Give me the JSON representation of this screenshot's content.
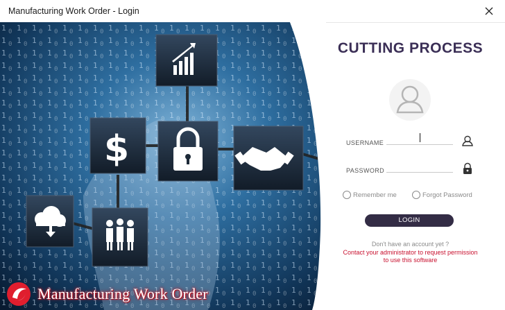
{
  "window": {
    "title": "Manufacturing Work Order - Login"
  },
  "brand": {
    "name": "Manufacturing Work Order"
  },
  "login": {
    "heading": "CUTTING PROCESS",
    "username_label": "USERNAME",
    "password_label": "PASSWORD",
    "username_value": "",
    "password_value": "",
    "remember_label": "Remember me",
    "forgot_label": "Forgot Password",
    "button_label": "LOGIN",
    "no_account_text": "Don't have an account yet ?",
    "contact_line1": "Contact your administrator to request permission",
    "contact_line2": "to use this software"
  },
  "colors": {
    "accent": "#3b2f56",
    "button": "#332c45",
    "link_red": "#c8102e",
    "brand_red": "#e01e2e"
  },
  "icons": [
    "close-icon",
    "user-avatar-icon",
    "user-icon",
    "lock-icon",
    "chart-icon",
    "dollar-icon",
    "padlock-icon",
    "handshake-icon",
    "cloud-icon",
    "people-icon",
    "brand-logo-icon"
  ]
}
